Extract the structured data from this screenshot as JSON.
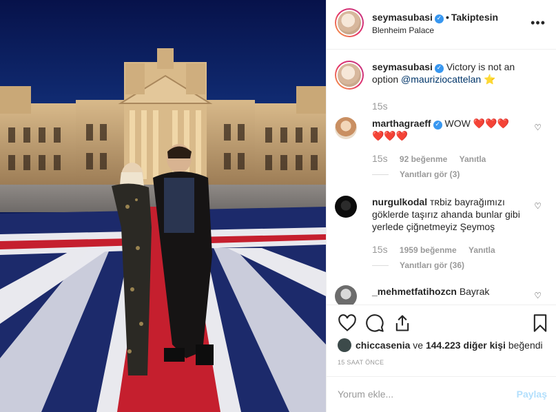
{
  "post": {
    "username": "seymasubasi",
    "follow_status": "Takiptesin",
    "separator": "•",
    "location": "Blenheim Palace",
    "more_icon": "more-horizontal-icon"
  },
  "caption": {
    "username": "seymasubasi",
    "text": "Victory is not an option",
    "mention": "@mauriziocattelan",
    "emoji": "⭐",
    "time": "15s"
  },
  "comments": [
    {
      "username": "marthagraeff",
      "text": "WOW",
      "hearts_line1": "❤️❤️❤️",
      "hearts_line2": "❤️❤️❤️",
      "time": "15s",
      "likes": "92 beğenme",
      "reply": "Yanıtla",
      "view_replies": "Yanıtları gör (3)"
    },
    {
      "username": "nurgulkodal",
      "text": "ᴛʀbiz bayrağımızı göklerde taşırız ahanda bunlar gibi yerlede çiğnetmeyiz Şeymoş",
      "time": "15s",
      "likes": "1959 beğenme",
      "reply": "Yanıtla",
      "view_replies": "Yanıtları gör (36)"
    },
    {
      "username": "_mehmetfatihozcn",
      "text": "Bayrak"
    }
  ],
  "likes": {
    "liker": "chiccasenia",
    "connector": "ve",
    "count_text": "144.223 diğer kişi",
    "suffix": "beğendi"
  },
  "time_ago": "15 SAAT ÖNCE",
  "add_comment": {
    "placeholder": "Yorum ekle...",
    "post_label": "Paylaş"
  },
  "colors": {
    "link": "#003569",
    "verified": "#3897f0",
    "muted": "#999999",
    "heart": "#ed2345",
    "post_disabled": "#b2dffc"
  }
}
